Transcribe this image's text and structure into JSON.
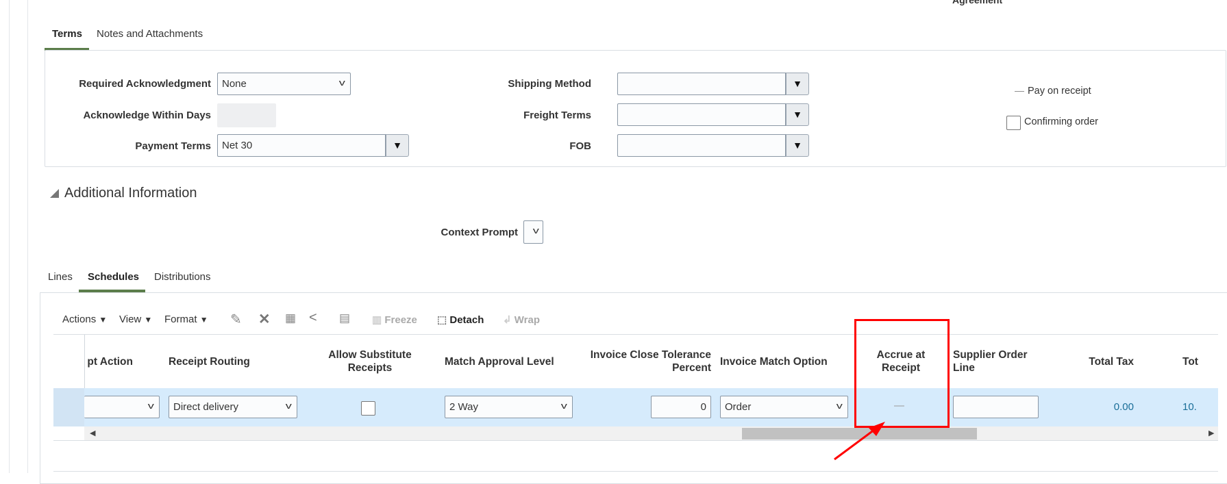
{
  "header": {
    "clipped_label": "Agreement"
  },
  "terms_tabs": [
    {
      "label": "Terms",
      "active": true
    },
    {
      "label": "Notes and Attachments",
      "active": false
    }
  ],
  "terms": {
    "required_ack_label": "Required Acknowledgment",
    "required_ack_value": "None",
    "ack_days_label": "Acknowledge Within Days",
    "ack_days_value": "",
    "payment_terms_label": "Payment Terms",
    "payment_terms_value": "Net 30",
    "shipping_method_label": "Shipping Method",
    "shipping_method_value": "",
    "freight_terms_label": "Freight Terms",
    "freight_terms_value": "",
    "fob_label": "FOB",
    "fob_value": "",
    "pay_on_receipt_value": "—",
    "pay_on_receipt_label": "Pay on receipt",
    "confirming_order_label": "Confirming order",
    "confirming_order_checked": false
  },
  "additional": {
    "title": "Additional Information",
    "context_prompt_label": "Context Prompt"
  },
  "line_tabs": [
    {
      "label": "Lines",
      "active": false
    },
    {
      "label": "Schedules",
      "active": true
    },
    {
      "label": "Distributions",
      "active": false
    }
  ],
  "toolbar": {
    "actions": "Actions",
    "view": "View",
    "format": "Format",
    "freeze": "Freeze",
    "detach": "Detach",
    "wrap": "Wrap"
  },
  "table": {
    "columns": [
      "pt Action",
      "Receipt Routing",
      "Allow Substitute Receipts",
      "Match Approval Level",
      "Invoice Close Tolerance Percent",
      "Invoice Match Option",
      "Accrue at Receipt",
      "Supplier Order Line",
      "Total Tax",
      "Tot"
    ],
    "row": {
      "receipt_action": "",
      "receipt_routing": "Direct delivery",
      "allow_substitute": false,
      "match_approval_level": "2 Way",
      "invoice_close_tolerance": "0",
      "invoice_match_option": "Order",
      "accrue_at_receipt": "—",
      "supplier_order_line": "",
      "total_tax": "0.00",
      "total": "10."
    }
  },
  "colors": {
    "accent_tab": "#5b7d4a",
    "highlight": "#ff0000",
    "row_selected": "#d6ebfc",
    "value_link": "#1a6e98"
  }
}
